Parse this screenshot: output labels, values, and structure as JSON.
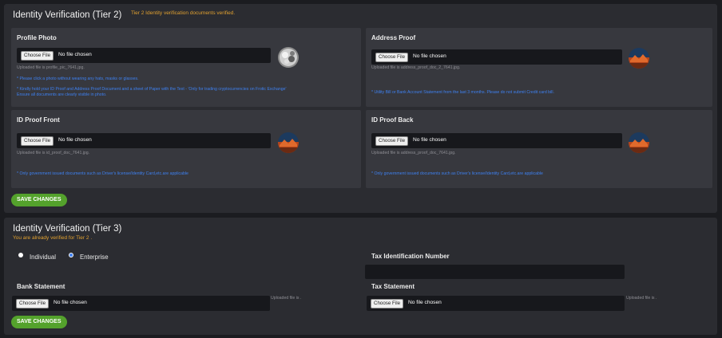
{
  "tier2": {
    "title": "Identity Verification (Tier 2)",
    "status": "Tier 2 Identity verification documents verified.",
    "choose_file": "Choose File",
    "no_file": "No file chosen",
    "save_label": "SAVE CHANGES",
    "profile": {
      "label": "Profile Photo",
      "uploaded": "Uploaded file is profile_pic_7641.jpg.",
      "hint1": "* Please click a photo without wearing any hats, masks or glasses.",
      "hint2": "* Kindly hold your ID Proof and Address Proof Document and a sheet of Paper with the Text - 'Only for trading cryptocurrencies on Frotic Exchange'",
      "hint3": "Ensure all documents are clearly visible in photo."
    },
    "address": {
      "label": "Address Proof",
      "uploaded": "Uploaded file is address_proof_doc_2_7641.jpg.",
      "hint": "* Utility Bill or Bank Account Statement from the last 3 months. Please do not submit Credit card bill."
    },
    "id_front": {
      "label": "ID Proof Front",
      "uploaded": "Uploaded file is id_proof_doc_7641.jpg.",
      "hint": "* Only government issued documents such as Driver's license/Identity Card,etc.are applicable"
    },
    "id_back": {
      "label": "ID Proof Back",
      "uploaded": "Uploaded file is address_proof_doc_7641.jpg.",
      "hint": "* Only government issued documents such as Driver's license/Identity Card,etc.are applicable"
    }
  },
  "tier3": {
    "title": "Identity Verification (Tier 3)",
    "status": "You are already verified for Tier 2 .",
    "individual": "Individual",
    "enterprise": "Enterprise",
    "tax_id_label": "Tax Identification Number",
    "bank_label": "Bank Statement",
    "tax_stmt_label": "Tax Statement",
    "choose_file": "Choose File",
    "no_file": "No file chosen",
    "uploaded_short": "Uploaded file is .",
    "save_label": "SAVE CHANGES"
  },
  "colors": {
    "panel": "#2b2c31",
    "card": "#37383e",
    "accent_orange": "#e0a030",
    "hint_blue": "#3e80f0",
    "button_green": "#54a22c"
  }
}
